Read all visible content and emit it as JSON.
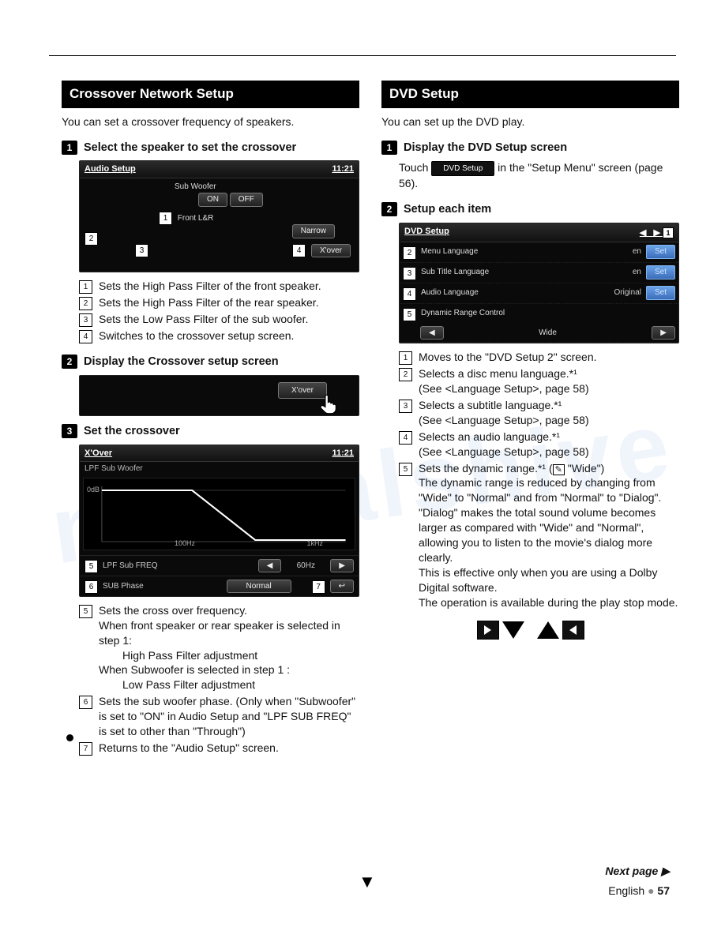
{
  "left": {
    "title": "Crossover Network Setup",
    "intro": "You can set a crossover frequency of speakers.",
    "step1": {
      "num": "1",
      "title": "Select the speaker to set the crossover",
      "ss": {
        "title": "Audio Setup",
        "time": "11:21",
        "sub": "Sub Woofer",
        "on": "ON",
        "off": "OFF",
        "front": "Front L&R",
        "narrow": "Narrow",
        "xover": "X'over"
      },
      "callouts": [
        "Sets the High Pass Filter of the front speaker.",
        "Sets the High Pass Filter of the rear speaker.",
        "Sets the Low Pass Filter of the sub woofer.",
        "Switches to the crossover setup screen."
      ]
    },
    "step2": {
      "num": "2",
      "title": "Display the Crossover setup screen",
      "ss": {
        "xover": "X'over"
      }
    },
    "step3": {
      "num": "3",
      "title": "Set the crossover",
      "ss": {
        "title": "X'Over",
        "time": "11:21",
        "lpf": "LPF Sub Woofer",
        "odb": "0dB",
        "a100": "100Hz",
        "a1k": "1kHz",
        "row5": "LPF Sub FREQ",
        "val5": "60Hz",
        "row6": "SUB Phase",
        "val6": "Normal"
      },
      "callouts": {
        "c5": "Sets the cross over frequency.",
        "c5a": "When front speaker or rear speaker is selected in step 1:",
        "c5b": "High Pass Filter adjustment",
        "c5c": "When Subwoofer is selected in step 1 :",
        "c5d": "Low Pass Filter adjustment",
        "c6": "Sets the sub woofer phase. (Only when \"Subwoofer\" is set to \"ON\" in Audio Setup and \"LPF SUB FREQ\" is set to other than \"Through\")",
        "c7": "Returns to the \"Audio Setup\" screen."
      }
    }
  },
  "right": {
    "title": "DVD Setup",
    "intro": "You can set up the DVD play.",
    "step1": {
      "num": "1",
      "title": "Display the DVD Setup screen",
      "textA": "Touch ",
      "chip": "DVD Setup",
      "textB": " in the \"Setup Menu\" screen (page 56)."
    },
    "step2": {
      "num": "2",
      "title": "Setup each item",
      "ss": {
        "title": "DVD Setup",
        "r2": "Menu Language",
        "v2": "en",
        "r3": "Sub Title Language",
        "v3": "en",
        "r4": "Audio Language",
        "v4": "Original",
        "r5": "Dynamic Range Control",
        "v5": "Wide",
        "set": "Set"
      },
      "callouts": {
        "c1": "Moves to the \"DVD Setup 2\" screen.",
        "c2": "Selects a disc menu language.*¹",
        "c2b": "(See <Language Setup>, page 58)",
        "c3": "Selects a subtitle language.*¹",
        "c3b": "(See <Language Setup>, page 58)",
        "c4": "Selects an audio language.*¹",
        "c4b": "(See <Language Setup>, page 58)",
        "c5a": "Sets the dynamic range.*¹ (",
        "c5icon": "✎",
        "c5b": " \"Wide\")",
        "c5text": "The dynamic range is reduced by changing from \"Wide\" to \"Normal\" and from \"Normal\" to \"Dialog\". \"Dialog\" makes the total sound volume becomes larger as compared with \"Wide\" and \"Normal\", allowing you to listen to the movie's dialog more clearly.",
        "c5text2": "This is effective only when you are using a Dolby Digital software.",
        "c5text3": "The operation is available during the play stop mode."
      }
    }
  },
  "footer": {
    "next": "Next page ▶",
    "lang": "English",
    "page": "57"
  }
}
